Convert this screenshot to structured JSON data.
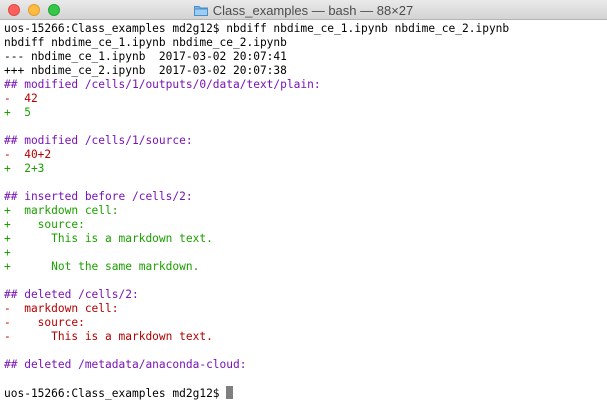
{
  "window": {
    "title": "Class_examples — bash — 88×27",
    "folder_icon": "folder-icon",
    "buttons": [
      "close",
      "minimize",
      "zoom"
    ]
  },
  "colors": {
    "header": "#7a13b6",
    "removed": "#b40000",
    "added": "#1ba000",
    "default": "#000000"
  },
  "terminal": {
    "lines": [
      {
        "kind": "default",
        "text": "uos-15266:Class_examples md2g12$ nbdiff nbdime_ce_1.ipynb nbdime_ce_2.ipynb"
      },
      {
        "kind": "default",
        "text": "nbdiff nbdime_ce_1.ipynb nbdime_ce_2.ipynb"
      },
      {
        "kind": "default",
        "text": "--- nbdime_ce_1.ipynb  2017-03-02 20:07:41"
      },
      {
        "kind": "default",
        "text": "+++ nbdime_ce_2.ipynb  2017-03-02 20:07:38"
      },
      {
        "kind": "header",
        "text": "## modified /cells/1/outputs/0/data/text/plain:"
      },
      {
        "kind": "removed",
        "text": "-  42"
      },
      {
        "kind": "added",
        "text": "+  5"
      },
      {
        "kind": "blank",
        "text": ""
      },
      {
        "kind": "header",
        "text": "## modified /cells/1/source:"
      },
      {
        "kind": "removed",
        "text": "-  40+2"
      },
      {
        "kind": "added",
        "text": "+  2+3"
      },
      {
        "kind": "blank",
        "text": ""
      },
      {
        "kind": "header",
        "text": "## inserted before /cells/2:"
      },
      {
        "kind": "added",
        "text": "+  markdown cell:"
      },
      {
        "kind": "added",
        "text": "+    source:"
      },
      {
        "kind": "added",
        "text": "+      This is a markdown text."
      },
      {
        "kind": "added",
        "text": "+"
      },
      {
        "kind": "added",
        "text": "+      Not the same markdown."
      },
      {
        "kind": "blank",
        "text": ""
      },
      {
        "kind": "header",
        "text": "## deleted /cells/2:"
      },
      {
        "kind": "removed",
        "text": "-  markdown cell:"
      },
      {
        "kind": "removed",
        "text": "-    source:"
      },
      {
        "kind": "removed",
        "text": "-      This is a markdown text."
      },
      {
        "kind": "blank",
        "text": ""
      },
      {
        "kind": "header",
        "text": "## deleted /metadata/anaconda-cloud:"
      },
      {
        "kind": "blank",
        "text": ""
      },
      {
        "kind": "prompt",
        "text": "uos-15266:Class_examples md2g12$ "
      }
    ]
  }
}
